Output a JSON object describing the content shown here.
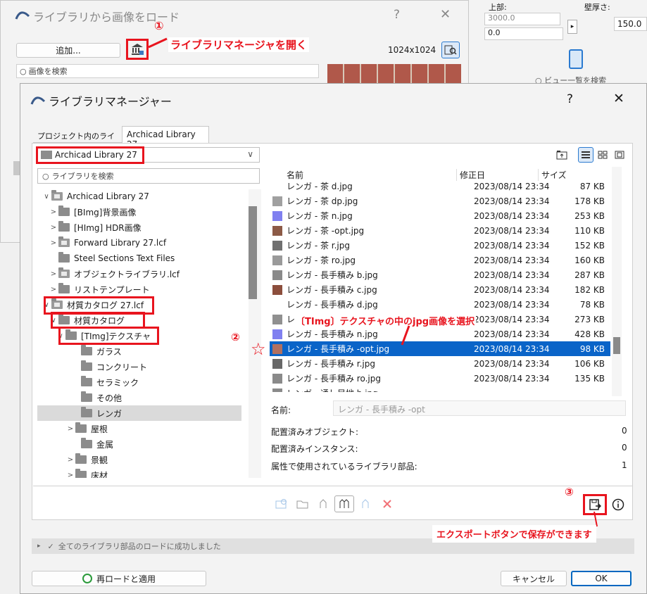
{
  "load_dialog": {
    "title": "ライブラリから画像をロード",
    "help": "?",
    "close": "✕",
    "add_button": "追加...",
    "search_placeholder": "画像を検索",
    "resolution": "1024x1024",
    "annotation_1_num": "①",
    "annotation_1_text": "ライブラリマネージャを開く"
  },
  "background_ui": {
    "top_label": "上部:",
    "val_3000": "3000.0",
    "val_0": "0.0",
    "wall_thickness_label": "壁厚さ:",
    "wall_thickness": "150.0",
    "view_search": "ビュー一覧を検索"
  },
  "manager": {
    "title": "ライブラリマネージャー",
    "help": "?",
    "close": "✕",
    "tabs": [
      {
        "label": "プロジェクト内のライブラリ"
      },
      {
        "label": "Archicad Library 27"
      }
    ],
    "library_select": "Archicad Library 27",
    "library_search_placeholder": "ライブラリを検索",
    "tree": [
      {
        "label": "Archicad Library 27",
        "chev": "∨"
      },
      {
        "label": "[BImg]背景画像",
        "chev": ">"
      },
      {
        "label": "[HImg] HDR画像",
        "chev": ">"
      },
      {
        "label": "Forward Library 27.lcf",
        "chev": ">"
      },
      {
        "label": "Steel Sections Text Files",
        "chev": ""
      },
      {
        "label": "オブジェクトライブラリ.lcf",
        "chev": ">"
      },
      {
        "label": "リストテンプレート",
        "chev": ">"
      },
      {
        "label": "材質カタログ 27.lcf",
        "chev": "∨"
      },
      {
        "label": "材質カタログ",
        "chev": "∨"
      },
      {
        "label": "[TImg]テクスチャ",
        "chev": "∨"
      },
      {
        "label": "ガラス",
        "chev": ""
      },
      {
        "label": "コンクリート",
        "chev": ""
      },
      {
        "label": "セラミック",
        "chev": ""
      },
      {
        "label": "その他",
        "chev": ""
      },
      {
        "label": "レンガ",
        "chev": ""
      },
      {
        "label": "屋根",
        "chev": ">"
      },
      {
        "label": "金属",
        "chev": ""
      },
      {
        "label": "景観",
        "chev": ">"
      },
      {
        "label": "床材",
        "chev": ">"
      }
    ],
    "columns": {
      "name": "名前",
      "modified": "修正日",
      "size": "サイズ"
    },
    "files": [
      {
        "name": "レンガ - 茶 d.jpg",
        "date": "2023/08/14 23:34",
        "size": "87 KB",
        "color": "#ffffff"
      },
      {
        "name": "レンガ - 茶 dp.jpg",
        "date": "2023/08/14 23:34",
        "size": "178 KB",
        "color": "#a0a0a0"
      },
      {
        "name": "レンガ - 茶 n.jpg",
        "date": "2023/08/14 23:34",
        "size": "253 KB",
        "color": "#8080f0"
      },
      {
        "name": "レンガ - 茶 -opt.jpg",
        "date": "2023/08/14 23:34",
        "size": "110 KB",
        "color": "#8c5a46"
      },
      {
        "name": "レンガ - 茶 r.jpg",
        "date": "2023/08/14 23:34",
        "size": "152 KB",
        "color": "#707070"
      },
      {
        "name": "レンガ - 茶 ro.jpg",
        "date": "2023/08/14 23:34",
        "size": "160 KB",
        "color": "#9a9a9a"
      },
      {
        "name": "レンガ - 長手積み b.jpg",
        "date": "2023/08/14 23:34",
        "size": "287 KB",
        "color": "#8a8a8a"
      },
      {
        "name": "レンガ - 長手積み c.jpg",
        "date": "2023/08/14 23:34",
        "size": "182 KB",
        "color": "#8c4e3c"
      },
      {
        "name": "レンガ - 長手積み d.jpg",
        "date": "2023/08/14 23:34",
        "size": "78 KB",
        "color": "#ffffff"
      },
      {
        "name": "レンガ - 長手積み dp.jpg",
        "date": "2023/08/14 23:34",
        "size": "273 KB",
        "color": "#909090"
      },
      {
        "name": "レンガ - 長手積み n.jpg",
        "date": "2023/08/14 23:34",
        "size": "428 KB",
        "color": "#8080f0"
      },
      {
        "name": "レンガ - 長手積み -opt.jpg",
        "date": "2023/08/14 23:34",
        "size": "98 KB",
        "color": "#b07060"
      },
      {
        "name": "レンガ - 長手積み r.jpg",
        "date": "2023/08/14 23:34",
        "size": "106 KB",
        "color": "#686868"
      },
      {
        "name": "レンガ - 長手積み ro.jpg",
        "date": "2023/08/14 23:34",
        "size": "135 KB",
        "color": "#8a8a8a"
      },
      {
        "name": "レンガ - 通し目地 b.jpg",
        "date": "",
        "size": "",
        "color": "#8a8a8a"
      }
    ],
    "detail": {
      "name_label": "名前:",
      "name_value": "レンガ - 長手積み -opt",
      "placed_objects_label": "配置済みオブジェクト:",
      "placed_objects_value": "0",
      "placed_instances_label": "配置済みインスタンス:",
      "placed_instances_value": "0",
      "attr_parts_label": "属性で使用されているライブラリ部品:",
      "attr_parts_value": "1"
    },
    "status": "全てのライブラリ部品のロードに成功しました",
    "reload_button": "再ロードと適用",
    "cancel_button": "キャンセル",
    "ok_button": "OK",
    "annotation_2_num": "②",
    "annotation_2_text": "〔TImg〕テクスチャの中のjpg画像を選択",
    "annotation_star": "☆",
    "annotation_3_num": "③",
    "annotation_3_text": "エクスポートボタンで保存ができます"
  },
  "colors": {
    "accent_red": "#e8141e",
    "selection_blue": "#0a64c8",
    "ok_border": "#0067c0"
  }
}
